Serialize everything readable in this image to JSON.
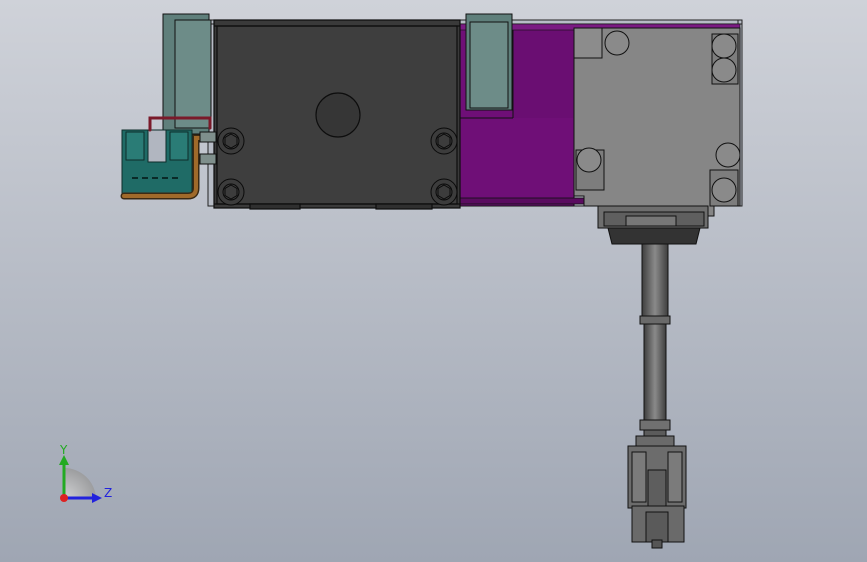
{
  "colors": {
    "bg_top": "#c9ccd4",
    "bg_bottom": "#a3a9b5",
    "housing_dark": "#3a3a3a",
    "housing_line": "#111111",
    "bracket_teal": "#5f7f7b",
    "panel_purple": "#6f0f77",
    "motor_gray": "#858585",
    "connector_gray": "#6a6a6a",
    "sensor_teal": "#1f6b66",
    "cable_brown": "#8a5a1e",
    "cable_red": "#7a1a2a",
    "axis_y": "#22aa22",
    "axis_z": "#2222dd",
    "axis_x": "#dd2222"
  },
  "parts": [
    {
      "name": "main-housing",
      "icon": "housing-block"
    },
    {
      "name": "mounting-brackets",
      "icon": "bracket"
    },
    {
      "name": "motor-block",
      "icon": "motor"
    },
    {
      "name": "cable-connector",
      "icon": "connector"
    },
    {
      "name": "photo-sensor",
      "icon": "sensor"
    }
  ],
  "triad": {
    "y_label": "Y",
    "z_label": "Z"
  }
}
